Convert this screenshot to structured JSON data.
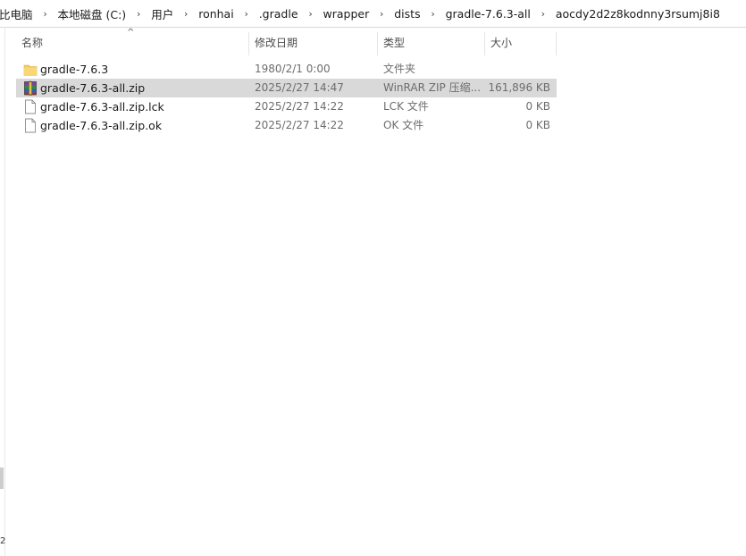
{
  "breadcrumb": {
    "items": [
      "比电脑",
      "本地磁盘 (C:)",
      "用户",
      "ronhai",
      ".gradle",
      "wrapper",
      "dists",
      "gradle-7.6.3-all",
      "aocdy2d2z8kodnny3rsumj8i8"
    ],
    "separator": "›"
  },
  "columns": {
    "name": "名称",
    "date": "修改日期",
    "type": "类型",
    "size": "大小",
    "sort_indicator": "^"
  },
  "files": [
    {
      "name": "gradle-7.6.3",
      "date": "1980/2/1 0:00",
      "type": "文件夹",
      "size": "",
      "icon": "folder-icon",
      "selected": false
    },
    {
      "name": "gradle-7.6.3-all.zip",
      "date": "2025/2/27 14:47",
      "type": "WinRAR ZIP 压缩...",
      "size": "161,896 KB",
      "icon": "winrar-archive-icon",
      "selected": true
    },
    {
      "name": "gradle-7.6.3-all.zip.lck",
      "date": "2025/2/27 14:22",
      "type": "LCK 文件",
      "size": "0 KB",
      "icon": "file-icon",
      "selected": false
    },
    {
      "name": "gradle-7.6.3-all.zip.ok",
      "date": "2025/2/27 14:22",
      "type": "OK 文件",
      "size": "0 KB",
      "icon": "file-icon",
      "selected": false
    }
  ],
  "edge_glyph": "2",
  "colors": {
    "selection": "#d9d9d9",
    "folder": "#f4c95d"
  }
}
